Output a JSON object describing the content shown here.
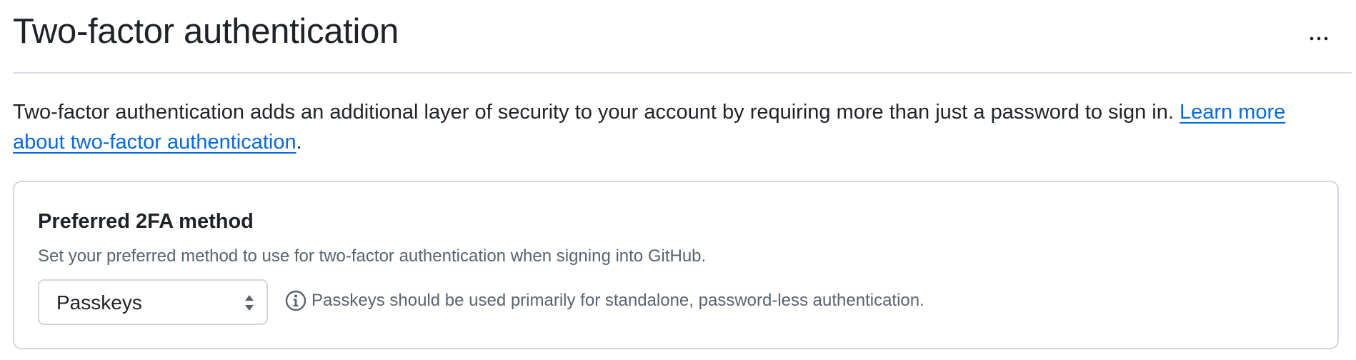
{
  "header": {
    "title": "Two-factor authentication",
    "more_icon": "kebab-horizontal-icon"
  },
  "intro": {
    "text": "Two-factor authentication adds an additional layer of security to your account by requiring more than just a password to sign in. ",
    "link_text": "Learn more about two-factor authentication",
    "trailing": "."
  },
  "preferred_method": {
    "title": "Preferred 2FA method",
    "description": "Set your preferred method to use for two-factor authentication when signing into GitHub.",
    "select": {
      "selected": "Passkeys",
      "caret_icon": "select-arrows-icon"
    },
    "hint": {
      "icon": "info-icon",
      "text": "Passkeys should be used primarily for standalone, password-less authentication."
    }
  },
  "colors": {
    "text": "#1f2328",
    "muted": "#59636e",
    "link": "#0969da",
    "border": "#d0d7de"
  }
}
